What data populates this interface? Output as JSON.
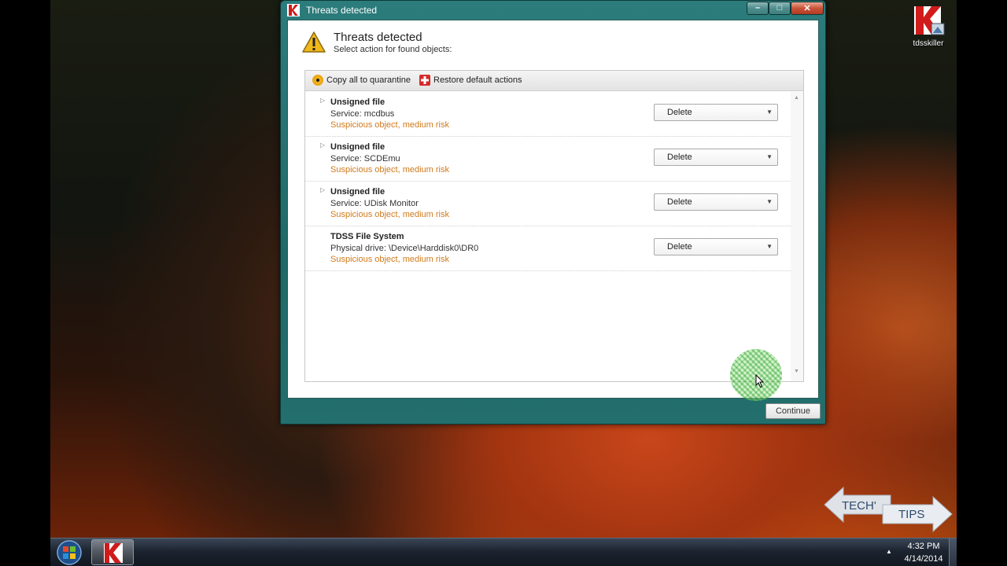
{
  "window": {
    "title": "Threats detected",
    "header_title": "Threats detected",
    "header_subtitle": "Select action for found objects:"
  },
  "toolbar": {
    "quarantine_label": "Copy all to quarantine",
    "restore_label": "Restore default actions"
  },
  "threats": [
    {
      "name": "Unsigned file",
      "detail": "Service: mcdbus",
      "risk": "Suspicious object, medium risk",
      "action": "Delete",
      "expandable": true
    },
    {
      "name": "Unsigned file",
      "detail": "Service: SCDEmu",
      "risk": "Suspicious object, medium risk",
      "action": "Delete",
      "expandable": true
    },
    {
      "name": "Unsigned file",
      "detail": "Service: UDisk Monitor",
      "risk": "Suspicious object, medium risk",
      "action": "Delete",
      "expandable": true
    },
    {
      "name": "TDSS File System",
      "detail": "Physical drive: \\Device\\Harddisk0\\DR0",
      "risk": "Suspicious object, medium risk",
      "action": "Delete",
      "expandable": false
    }
  ],
  "buttons": {
    "continue_label": "Continue"
  },
  "desktop": {
    "icon_label": "tdsskiller"
  },
  "watermark": {
    "word1": "TECH'",
    "word2": "TIPS"
  },
  "taskbar": {
    "time": "4:32 PM",
    "date": "4/14/2014"
  },
  "colors": {
    "window_frame": "#2c7c7c",
    "risk_text": "#d07a1c",
    "kaspersky_red": "#d11b1b"
  }
}
